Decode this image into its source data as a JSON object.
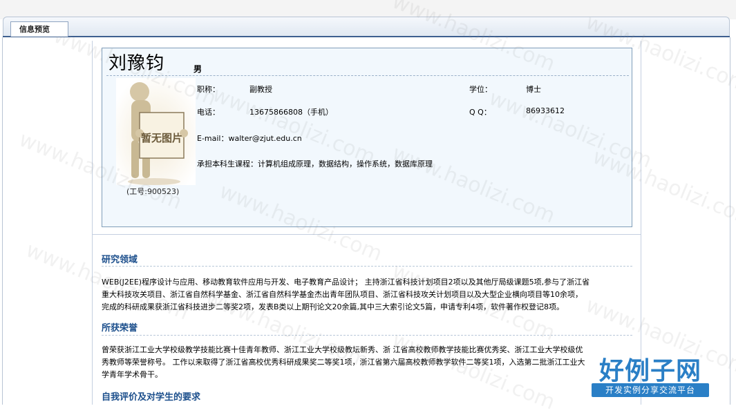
{
  "tab": {
    "label": "信息预览"
  },
  "profile": {
    "name": "刘豫钧",
    "gender": "男",
    "photo_text": "暂无图片",
    "employee_id": "(工号:900523)",
    "title_label": "职称：",
    "title_value": "副教授",
    "degree_label": "学位：",
    "degree_value": "博士",
    "phone_label": "电话：",
    "phone_value": "13675866808（手机）",
    "qq_label": "Q  Q：",
    "qq_value": "86933612",
    "email_label": "E-mail：",
    "email_value": "walter@zjut.edu.cn",
    "courses_label": "承担本科生课程：",
    "courses_value": "计算机组成原理，数据结构，操作系统，数据库原理"
  },
  "sections": {
    "research_title": "研究领域",
    "research_lines": [
      "WEB(J2EE)程序设计与应用、移动教育软件应用与开发、电子教育产品设计；  主持浙江省科技计划项目2项以及其他厅局级课题5项,参与了浙江省",
      "重大科技攻关项目、浙江省自然科学基金、浙江省自然科学基金杰出青年团队项目、浙江省科技攻关计划项目以及大型企业横向项目等10余项，",
      "完成的科研成果获浙江省科技进步二等奖2项，发表B类以上期刊论文20余篇,其中三大索引论文5篇，申请专利4项，软件著作权登记8项。"
    ],
    "honors_title": "所获荣誉",
    "honors_lines": [
      "曾荣获浙江工业大学校级教学技能比赛十佳青年教师、浙江工业大学校级教坛新秀、浙 江省高校教师教学技能比赛优秀奖、浙江工业大学校级优",
      "秀教师等荣誉称号。 工作以来取得了浙江省高校优秀科研成果奖二等奖1项，浙江省第六届高校教师教学软件二等奖1项，入选第二批浙江工业大",
      "学青年学术骨干。"
    ],
    "evaluation_title": "自我评价及对学生的要求"
  },
  "watermark": {
    "text": "www.haolizi.com"
  },
  "logo": {
    "main": "好例子网",
    "sub": "开发实例分享交流平台"
  },
  "colors": {
    "accent": "#1c4f8c",
    "card_bg": "#f2f8fd",
    "card_border": "#7f9db9",
    "logo": "#2a7fc6"
  }
}
